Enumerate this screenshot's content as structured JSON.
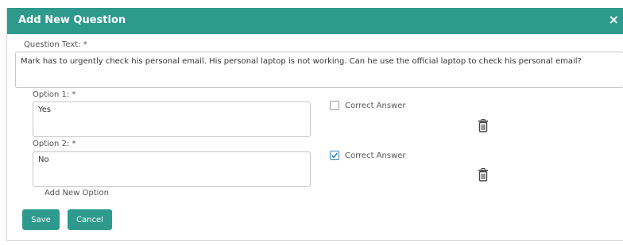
{
  "dialog": {
    "title": "Add New Question",
    "close_glyph": "×"
  },
  "question": {
    "label": "Question Text: *",
    "value": "Mark has to urgently check his personal email. His personal laptop is not working. Can he use the official laptop to check his personal email?"
  },
  "options": [
    {
      "label": "Option 1: *",
      "value": "Yes",
      "correct_label": "Correct Answer",
      "correct": false
    },
    {
      "label": "Option 2: *",
      "value": "No",
      "correct_label": "Correct Answer",
      "correct": true
    }
  ],
  "add_option_label": "Add New Option",
  "buttons": {
    "save": "Save",
    "cancel": "Cancel"
  },
  "icons": {
    "close": "close-icon",
    "trash": "trash-icon",
    "check": "checkmark-icon"
  },
  "colors": {
    "accent": "#2e9a8e",
    "check": "#3a86b8"
  }
}
